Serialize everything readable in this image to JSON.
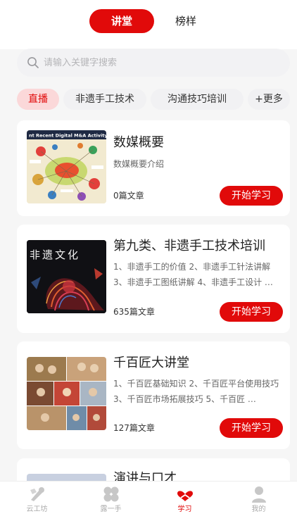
{
  "segments": {
    "active": "讲堂",
    "inactive": "榜样"
  },
  "search": {
    "placeholder": "请输入关键字搜索"
  },
  "categories": [
    "直播",
    "非遗手工技术",
    "沟通技巧培训",
    "+更多"
  ],
  "courses": [
    {
      "title": "数媒概要",
      "description": "数媒概要介绍",
      "count": "0篇文章",
      "button": "开始学习",
      "thumb_caption": "nt Recent Digital M&A Activity"
    },
    {
      "title": "第九类、非遗手工技术培训",
      "description": "1、非遗手工的价值  2、非遗手工针法讲解  3、非遗手工图纸讲解 4、非遗手工设计 …",
      "count": "635篇文章",
      "button": "开始学习",
      "thumb_caption": "非遗文化"
    },
    {
      "title": "千百匠大讲堂",
      "description": "1、千百匠基础知识  2、千百匠平台使用技巧 3、千百匠市场拓展技巧 5、千百匠  …",
      "count": "127篇文章",
      "button": "开始学习"
    },
    {
      "title": "演讲与口才"
    }
  ],
  "tabbar": [
    {
      "label": "云工坊",
      "icon": "tools-icon"
    },
    {
      "label": "露一手",
      "icon": "clover-icon"
    },
    {
      "label": "学习",
      "icon": "heart-study-icon"
    },
    {
      "label": "我的",
      "icon": "person-icon"
    }
  ],
  "colors": {
    "accent": "#e10a0a",
    "chip_active_bg": "#fbd8d9",
    "background": "#f6f6f6"
  }
}
